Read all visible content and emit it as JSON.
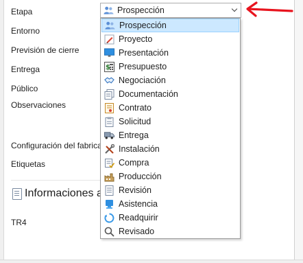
{
  "form": {
    "labels": {
      "etapa": "Etapa",
      "entorno": "Entorno",
      "prevision": "Previsión de cierre",
      "entrega": "Entrega",
      "publico": "Público",
      "observaciones": "Observaciones",
      "configuracion": "Configuración del fabrica",
      "etiquetas": "Etiquetas",
      "tr4": "TR4"
    },
    "section_title": "Informaciones a"
  },
  "combo": {
    "selected_label": "Prospección",
    "selected_icon": "people-icon"
  },
  "dropdown": {
    "items": [
      {
        "label": "Prospección",
        "icon": "people-icon",
        "selected": true
      },
      {
        "label": "Proyecto",
        "icon": "pencil-icon"
      },
      {
        "label": "Presentación",
        "icon": "monitor-icon"
      },
      {
        "label": "Presupuesto",
        "icon": "calculator-icon"
      },
      {
        "label": "Negociación",
        "icon": "handshake-icon"
      },
      {
        "label": "Documentación",
        "icon": "documents-icon"
      },
      {
        "label": "Contrato",
        "icon": "contract-icon"
      },
      {
        "label": "Solicitud",
        "icon": "request-icon"
      },
      {
        "label": "Entrega",
        "icon": "truck-icon"
      },
      {
        "label": "Instalación",
        "icon": "tools-icon"
      },
      {
        "label": "Compra",
        "icon": "purchase-icon"
      },
      {
        "label": "Producción",
        "icon": "production-icon"
      },
      {
        "label": "Revisión",
        "icon": "review-icon"
      },
      {
        "label": "Asistencia",
        "icon": "assistance-icon"
      },
      {
        "label": "Readquirir",
        "icon": "recycle-icon"
      },
      {
        "label": "Revisado",
        "icon": "magnifier-icon"
      }
    ]
  },
  "colors": {
    "selection_bg": "#cce8ff",
    "selection_border": "#99d1ff",
    "annotation_arrow": "#e8141e"
  }
}
